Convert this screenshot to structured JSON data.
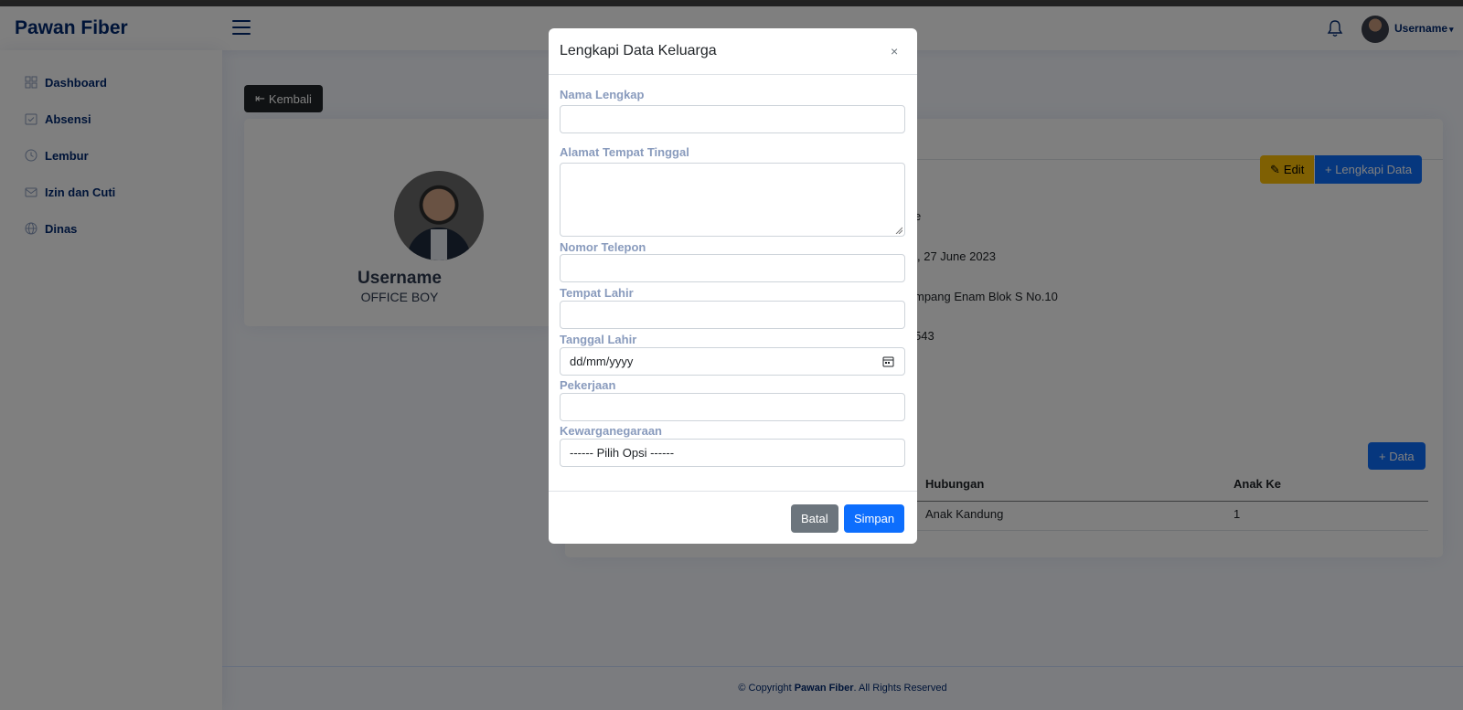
{
  "header": {
    "logo": "Pawan Fiber",
    "username": "Username"
  },
  "sidebar": {
    "items": [
      {
        "label": "Dashboard",
        "icon": "grid-icon"
      },
      {
        "label": "Absensi",
        "icon": "calendar-check-icon"
      },
      {
        "label": "Lembur",
        "icon": "clock-icon"
      },
      {
        "label": "Izin dan Cuti",
        "icon": "envelope-icon"
      },
      {
        "label": "Dinas",
        "icon": "globe-icon"
      }
    ]
  },
  "main": {
    "back_label": "Kembali",
    "profile": {
      "name": "Username",
      "role": "OFFICE BOY"
    },
    "detail": {
      "edit_label": "Edit",
      "lengkapi_label": "+ Lengkapi Data",
      "visible_values": [
        "e",
        ", 27 June 2023",
        "mpang Enam Blok S No.10",
        "543"
      ],
      "add_data_label": "+ Data",
      "table": {
        "headers": [
          "Hubungan",
          "Anak Ke"
        ],
        "rows": [
          [
            "Anak Kandung",
            "1"
          ]
        ]
      }
    }
  },
  "modal": {
    "title": "Lengkapi Data Keluarga",
    "close": "×",
    "fields": {
      "nama_label": "Nama Lengkap",
      "alamat_label": "Alamat Tempat Tinggal",
      "telepon_label": "Nomor Telepon",
      "tempat_lahir_label": "Tempat Lahir",
      "tanggal_lahir_label": "Tanggal Lahir",
      "tanggal_lahir_value": "dd/mm/yyyy",
      "pekerjaan_label": "Pekerjaan",
      "kewarganegaraan_label": "Kewarganegaraan",
      "kewarganegaraan_value": "------ Pilih Opsi ------"
    },
    "batal_label": "Batal",
    "simpan_label": "Simpan"
  },
  "footer": {
    "prefix": "© Copyright ",
    "brand": "Pawan Fiber",
    "suffix": ". All Rights Reserved"
  },
  "colors": {
    "brand": "#012970",
    "primary": "#0d6efd",
    "warning": "#ffc107",
    "secondary": "#6c757d",
    "label": "#899bbd"
  }
}
